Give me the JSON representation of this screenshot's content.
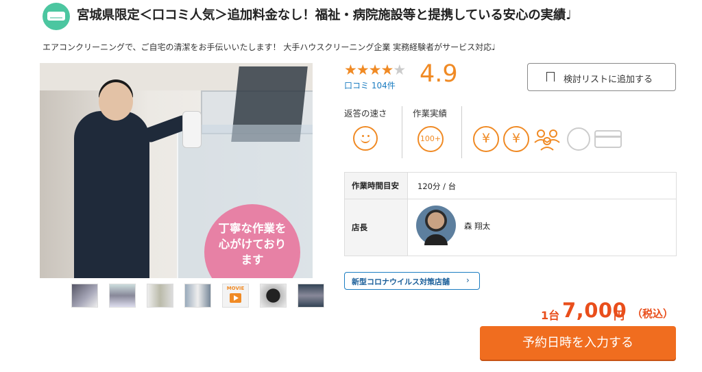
{
  "header": {
    "title": "宮城県限定＜口コミ人気＞追加料金なし！福祉・病院施設等と提携している安心の実績♩",
    "subtitle": "エアコンクリーニングで、ご自宅の清潔をお手伝いいたします！ 大手ハウスクリーニング企業 実務経験者がサービス対応♩"
  },
  "photo": {
    "overlay_text_1": "丁寧な作業を",
    "overlay_text_2": "心がけており",
    "overlay_text_3": "ます"
  },
  "thumbnails": {
    "movie_label": "MOVIE"
  },
  "rating": {
    "stars_filled": "★★★★",
    "stars_empty": "★",
    "score": "4.9",
    "reviews_label": "口コミ 104件"
  },
  "actions": {
    "add_to_list": "検討リストに追加する",
    "reserve": "予約日時を入力する"
  },
  "badges": {
    "response_speed_label": "返答の速さ",
    "track_record_label": "作業実績",
    "track_record_badge": "100+"
  },
  "info_table": {
    "work_time_label": "作業時間目安",
    "work_time_value": "120分 / 台",
    "manager_label": "店長",
    "manager_name": "森 翔太"
  },
  "corona": {
    "label": "新型コロナウイルス対策店舗",
    "arrow": "›"
  },
  "price": {
    "unit": "1台",
    "amount": "7,000",
    "yen": "円",
    "tax": "（税込）"
  },
  "colors": {
    "accent_orange": "#f08a24",
    "price_red": "#e94e1b",
    "link_blue": "#1a7cc1",
    "category_green": "#4cc6a0"
  }
}
